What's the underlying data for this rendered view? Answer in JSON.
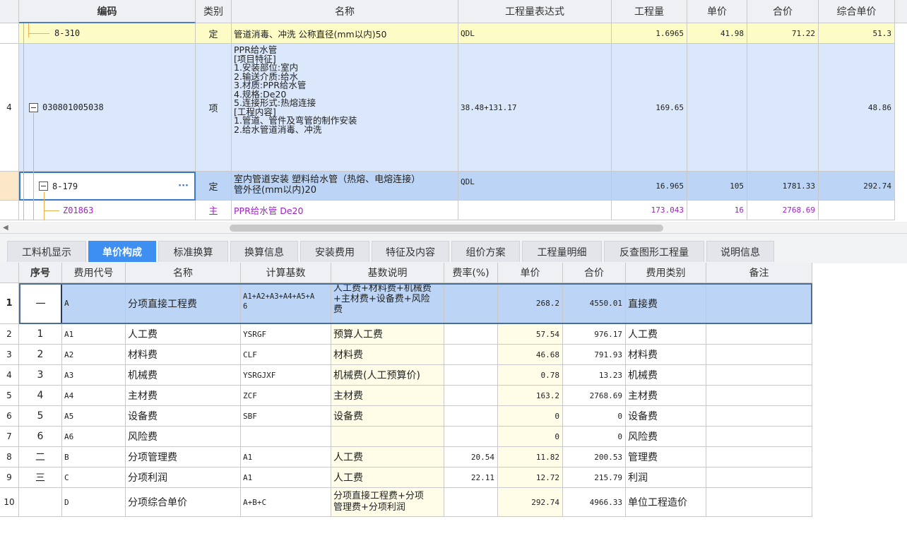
{
  "top_grid": {
    "headers": {
      "code": "编码",
      "type": "类别",
      "name": "名称",
      "expr": "工程量表达式",
      "qty": "工程量",
      "price": "单价",
      "total": "合价",
      "unit_price": "综合单价"
    },
    "rows": [
      {
        "num": "",
        "code": "8-310",
        "type": "定",
        "name": "管道消毒、冲洗 公称直径(mm以内)50",
        "expr": "QDL",
        "qty": "1.6965",
        "price": "41.98",
        "total": "71.22",
        "unit_price": "51.3"
      },
      {
        "num": "4",
        "code": "030801005038",
        "type": "项",
        "name_lines": [
          "PPR给水管",
          "[项目特征]",
          "1.安装部位:室内",
          "2.输送介质:给水",
          "3.材质:PPR给水管",
          "4.规格:De20",
          "5.连接形式:热熔连接",
          "[工程内容]",
          "1.管道、管件及弯管的制作安装",
          "2.给水管道消毒、冲洗"
        ],
        "expr": "38.48+131.17",
        "qty": "169.65",
        "price": "",
        "total": "",
        "unit_price": "48.86"
      },
      {
        "num": "",
        "code": "8-179",
        "type": "定",
        "name_lines": [
          "室内管道安装 塑料给水管（热熔、电熔连接）",
          "管外径(mm以内)20"
        ],
        "expr": "QDL",
        "qty": "16.965",
        "price": "105",
        "total": "1781.33",
        "unit_price": "292.74",
        "more": "···"
      },
      {
        "num": "",
        "code": "Z01863",
        "type": "主",
        "name": "PPR给水管 De20",
        "expr": "",
        "qty": "173.043",
        "price": "16",
        "total": "2768.69",
        "unit_price": ""
      }
    ]
  },
  "scrollbar": {
    "left_arrow": "◀"
  },
  "tabs": [
    "工料机显示",
    "单价构成",
    "标准换算",
    "换算信息",
    "安装费用",
    "特征及内容",
    "组价方案",
    "工程量明细",
    "反查图形工程量",
    "说明信息"
  ],
  "active_tab": "单价构成",
  "bottom_grid": {
    "headers": {
      "seq": "序号",
      "code": "费用代号",
      "name": "名称",
      "base": "计算基数",
      "desc": "基数说明",
      "rate": "费率(%)",
      "price": "单价",
      "total": "合价",
      "category": "费用类别",
      "note": "备注"
    },
    "rows": [
      {
        "num": "1",
        "seq": "一",
        "code": "A",
        "name": "分项直接工程费",
        "base_lines": [
          "A1+A2+A3+A4+A5+A",
          "6"
        ],
        "desc_lines": [
          "人工费+材料费+机械费",
          "+主材费+设备费+风险",
          "费"
        ],
        "rate": "",
        "price": "268.2",
        "total": "4550.01",
        "category": "直接费"
      },
      {
        "num": "2",
        "seq": "1",
        "code": "A1",
        "name": "人工费",
        "base": "YSRGF",
        "desc": "预算人工费",
        "rate": "",
        "price": "57.54",
        "total": "976.17",
        "category": "人工费"
      },
      {
        "num": "3",
        "seq": "2",
        "code": "A2",
        "name": "材料费",
        "base": "CLF",
        "desc": "材料费",
        "rate": "",
        "price": "46.68",
        "total": "791.93",
        "category": "材料费"
      },
      {
        "num": "4",
        "seq": "3",
        "code": "A3",
        "name": "机械费",
        "base": "YSRGJXF",
        "desc": "机械费(人工预算价)",
        "rate": "",
        "price": "0.78",
        "total": "13.23",
        "category": "机械费"
      },
      {
        "num": "5",
        "seq": "4",
        "code": "A4",
        "name": "主材费",
        "base": "ZCF",
        "desc": "主材费",
        "rate": "",
        "price": "163.2",
        "total": "2768.69",
        "category": "主材费"
      },
      {
        "num": "6",
        "seq": "5",
        "code": "A5",
        "name": "设备费",
        "base": "SBF",
        "desc": "设备费",
        "rate": "",
        "price": "0",
        "total": "0",
        "category": "设备费"
      },
      {
        "num": "7",
        "seq": "6",
        "code": "A6",
        "name": "风险费",
        "base": "",
        "desc": "",
        "rate": "",
        "price": "0",
        "total": "0",
        "category": "风险费"
      },
      {
        "num": "8",
        "seq": "二",
        "code": "B",
        "name": "分项管理费",
        "base": "A1",
        "desc": "人工费",
        "rate": "20.54",
        "price": "11.82",
        "total": "200.53",
        "category": "管理费"
      },
      {
        "num": "9",
        "seq": "三",
        "code": "C",
        "name": "分项利润",
        "base": "A1",
        "desc": "人工费",
        "rate": "22.11",
        "price": "12.72",
        "total": "215.79",
        "category": "利润"
      },
      {
        "num": "10",
        "seq": "",
        "code": "D",
        "name": "分项综合单价",
        "base": "A+B+C",
        "desc_lines": [
          "分项直接工程费+分项",
          "管理费+分项利润"
        ],
        "rate": "",
        "price": "292.74",
        "total": "4966.33",
        "category": "单位工程造价"
      }
    ]
  },
  "colors": {
    "active_tab": "#3d8ff2",
    "yellow_row": "#fefcc6",
    "blue_row": "#dbe8fb",
    "selected_row": "#bcd5f6",
    "main_material": "#a020c8"
  }
}
